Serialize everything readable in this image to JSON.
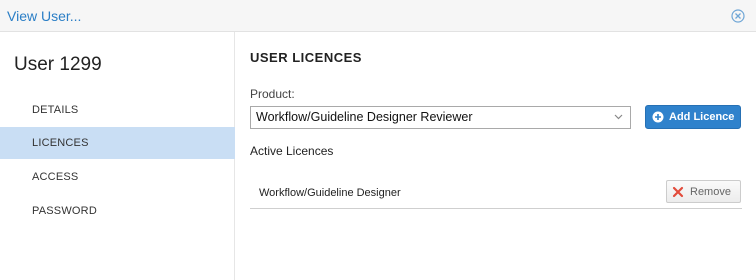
{
  "window": {
    "title": "View User...",
    "close_icon": "close-circle-icon"
  },
  "sidebar": {
    "user_name": "User 1299",
    "items": [
      {
        "label": "DETAILS",
        "active": false
      },
      {
        "label": "LICENCES",
        "active": true
      },
      {
        "label": "ACCESS",
        "active": false
      },
      {
        "label": "PASSWORD",
        "active": false
      }
    ]
  },
  "main": {
    "section_title": "USER LICENCES",
    "product_label": "Product:",
    "product_select": {
      "value": "Workflow/Guideline Designer Reviewer",
      "caret_icon": "chevron-down-icon"
    },
    "add_button": {
      "label": "Add Licence",
      "icon": "plus-circle-icon"
    },
    "active_heading": "Active Licences",
    "licences": [
      {
        "name": "Workflow/Guideline Designer",
        "remove_label": "Remove",
        "remove_icon": "x-icon"
      }
    ]
  },
  "colors": {
    "accent": "#2f82cc",
    "title_link": "#2a7ec6",
    "active_nav_bg": "#c9def4",
    "remove_icon": "#e24b3b"
  }
}
